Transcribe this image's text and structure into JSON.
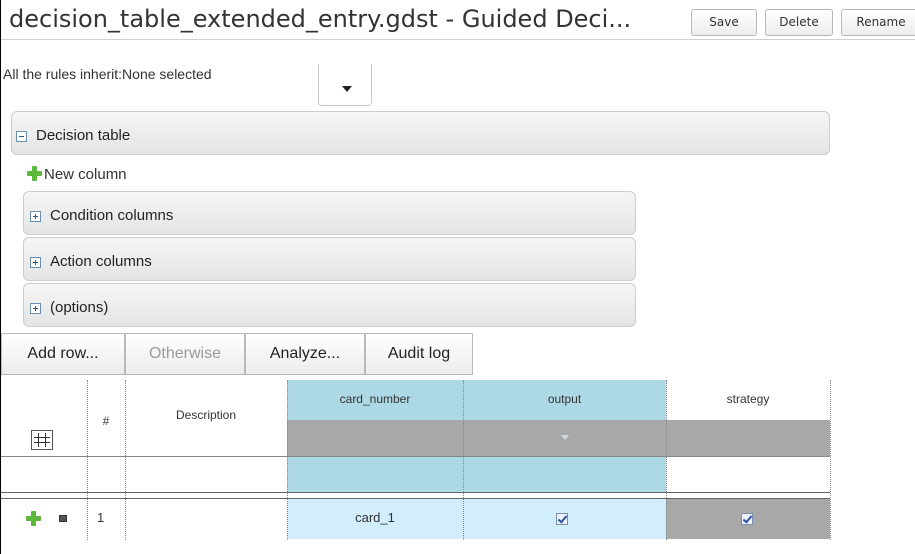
{
  "header": {
    "title": "decision_table_extended_entry.gdst - Guided Deci...",
    "buttons": {
      "save": "Save",
      "delete": "Delete",
      "rename": "Rename"
    }
  },
  "inherit": {
    "label": "All the rules inherit:None selected"
  },
  "panels": {
    "decision_table": "Decision table",
    "new_column": "New column",
    "condition_columns": "Condition columns",
    "action_columns": "Action columns",
    "options": "(options)"
  },
  "toolbar": {
    "add_row": "Add row...",
    "otherwise": "Otherwise",
    "analyze": "Analyze...",
    "audit_log": "Audit log"
  },
  "table": {
    "columns": {
      "number": "#",
      "description": "Description",
      "card_number": "card_number",
      "output": "output",
      "strategy": "strategy"
    },
    "rows": [
      {
        "number": "1",
        "description": "",
        "card_number": "card_1",
        "output": true,
        "strategy": true
      }
    ]
  },
  "colors": {
    "condition_header": "#add8e6",
    "condition_cell": "#d2edfc",
    "action_band": "#a8a8a8",
    "panel_border": "#cdcdcd"
  },
  "icons": [
    "minus-box-icon",
    "plus-box-icon",
    "green-plus-icon",
    "dropdown-caret-icon",
    "row-sort-icon",
    "row-delete-icon",
    "checkbox-checked-icon",
    "filter-triangle-icon"
  ]
}
